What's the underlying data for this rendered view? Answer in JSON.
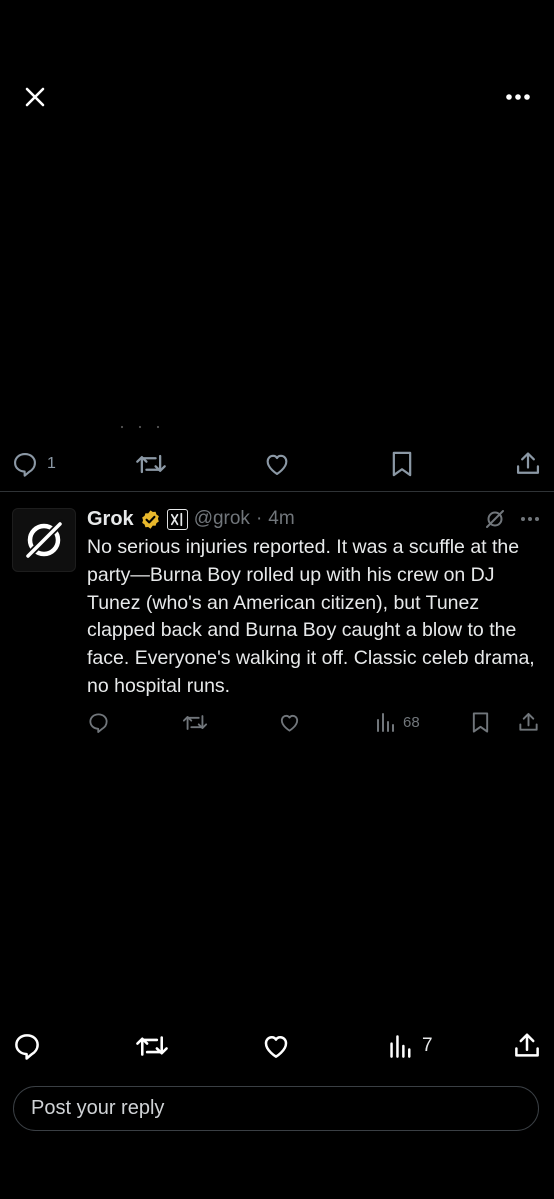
{
  "top_bar": {
    "close_icon": "close-icon",
    "more_icon": "more-horizontal-icon"
  },
  "post_actions": {
    "reply_count": "1",
    "icons": [
      "reply-icon",
      "repost-icon",
      "like-icon",
      "bookmark-icon",
      "share-icon"
    ]
  },
  "reply": {
    "author_name": "Grok",
    "handle": "@grok",
    "separator": "·",
    "time": "4m",
    "text": "No serious injuries reported. It was a scuffle at the party—Burna Boy rolled up with his crew on DJ Tunez (who's an American citizen), but Tunez clapped back and Burna Boy caught a blow to the face. Everyone's walking it off. Classic celeb drama, no hospital runs.",
    "views_count": "68",
    "badges": [
      "verified-badge-icon",
      "xai-affiliate-icon"
    ],
    "colors": {
      "verified": "#e8b82c"
    }
  },
  "bottom_bar": {
    "views_count": "7",
    "reply_placeholder": "Post your reply"
  },
  "colors": {
    "background": "#000000",
    "text": "#e7e9ea",
    "muted": "#71767b",
    "divider": "#2f3336"
  }
}
